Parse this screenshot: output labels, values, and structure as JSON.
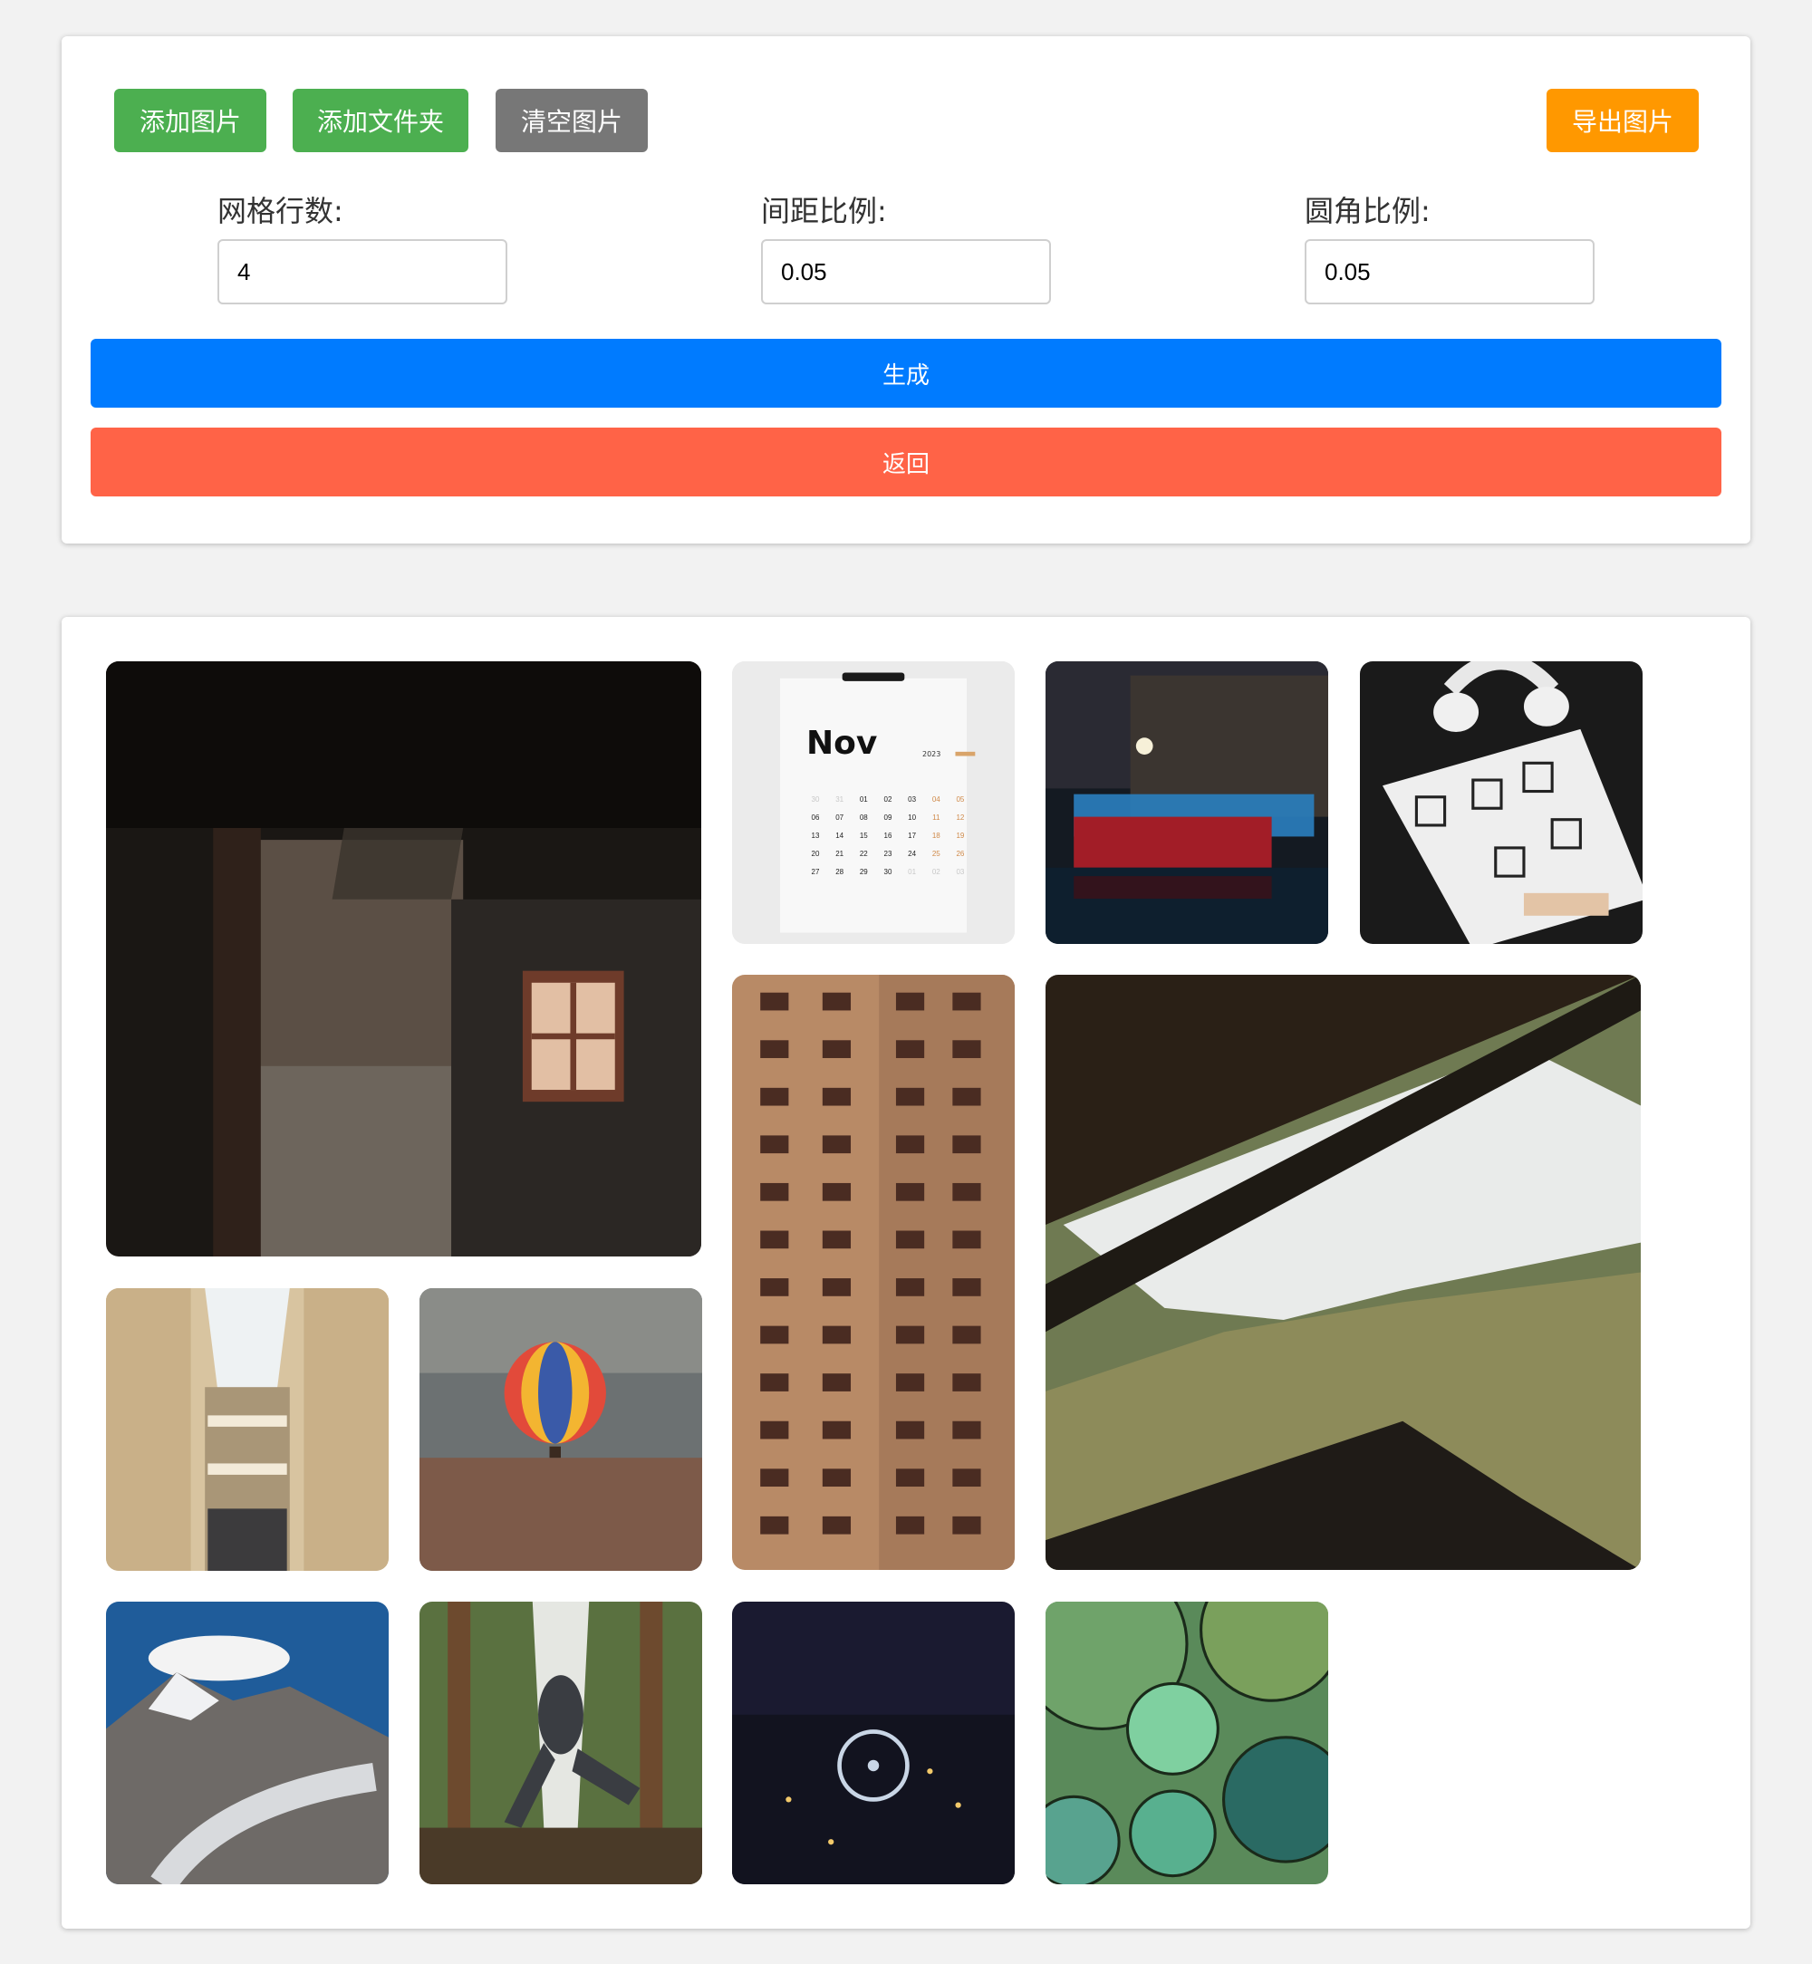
{
  "toolbar": {
    "add_images": "添加图片",
    "add_folder": "添加文件夹",
    "clear_images": "清空图片",
    "export_image": "导出图片"
  },
  "settings": {
    "grid_rows_label": "网格行数:",
    "grid_rows_value": "4",
    "spacing_label": "间距比例:",
    "spacing_value": "0.05",
    "corner_label": "圆角比例:",
    "corner_value": "0.05"
  },
  "actions": {
    "generate": "生成",
    "back": "返回"
  },
  "calendar": {
    "month": "Nov",
    "year": "2023",
    "rows": [
      [
        "30",
        "31",
        "01",
        "02",
        "03",
        "04",
        "05"
      ],
      [
        "06",
        "07",
        "08",
        "09",
        "10",
        "11",
        "12"
      ],
      [
        "13",
        "14",
        "15",
        "16",
        "17",
        "18",
        "19"
      ],
      [
        "20",
        "21",
        "22",
        "23",
        "24",
        "25",
        "26"
      ],
      [
        "27",
        "28",
        "29",
        "30",
        "01",
        "02",
        "03"
      ]
    ]
  },
  "colors": {
    "green": "#4caf50",
    "gray": "#777777",
    "orange": "#ff9800",
    "blue": "#007bff",
    "red": "#ff6347"
  }
}
